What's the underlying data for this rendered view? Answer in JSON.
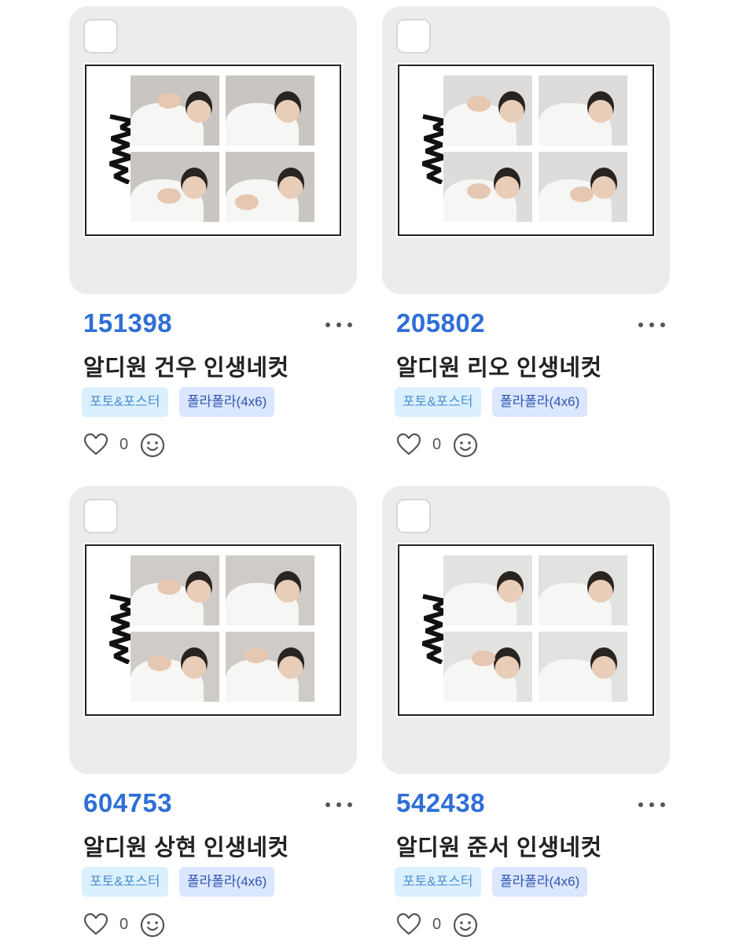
{
  "products": [
    {
      "price": "151398",
      "title": "알디원 건우 인생네컷",
      "tags": [
        "포토&포스터",
        "폴라폴라(4x6)"
      ],
      "likes": "0"
    },
    {
      "price": "205802",
      "title": "알디원 리오 인생네컷",
      "tags": [
        "포토&포스터",
        "폴라폴라(4x6)"
      ],
      "likes": "0"
    },
    {
      "price": "604753",
      "title": "알디원 상현 인생네컷",
      "tags": [
        "포토&포스터",
        "폴라폴라(4x6)"
      ],
      "likes": "0"
    },
    {
      "price": "542438",
      "title": "알디원 준서 인생네컷",
      "tags": [
        "포토&포스터",
        "폴라폴라(4x6)"
      ],
      "likes": "0"
    }
  ],
  "icons": {
    "more": "more-icon",
    "like": "heart-icon",
    "react": "smile-icon"
  },
  "colors": {
    "price": "#2f6fd6",
    "tag_category_bg": "#dbf0ff",
    "tag_option_bg": "#dbe6ff",
    "card_bg": "#ececef"
  }
}
